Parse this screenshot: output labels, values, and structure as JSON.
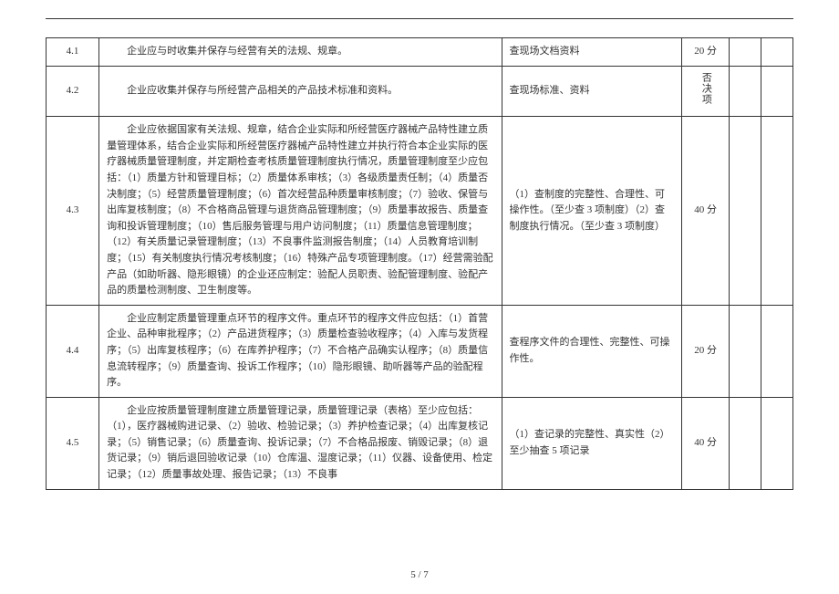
{
  "page": {
    "footer": "5 / 7"
  },
  "rows": {
    "r1": {
      "num": "4.1",
      "content": "企业应与时收集并保存与经营有关的法规、规章。",
      "method": "查现场文档资料",
      "score": "20 分"
    },
    "r2": {
      "num": "4.2",
      "content": "企业应收集并保存与所经营产品相关的产品技术标准和资料。",
      "method": "查现场标准、资料",
      "score": "否决项"
    },
    "r3": {
      "num": "4.3",
      "content": "企业应依据国家有关法规、规章，结合企业实际和所经营医疗器械产品特性建立质量管理体系，结合企业实际和所经营医疗器械产品特性建立并执行符合本企业实际的医疗器械质量管理制度，并定期检查考核质量管理制度执行情况，质量管理制度至少应包括：（1）质量方针和管理目标；（2）质量体系审核；（3）各级质量责任制；（4）质量否决制度；（5）经营质量管理制度；（6）首次经营品种质量审核制度；（7）验收、保管与出库复核制度；（8）不合格商品管理与退货商品管理制度；（9）质量事故报告、质量查询和投诉管理制度；（10）售后服务管理与用户访问制度；（11）质量信息管理制度；（12）有关质量记录管理制度；（13）不良事件监测报告制度；（14）人员教育培训制度；（15）有关制度执行情况考核制度；（16）特殊产品专项管理制度。（17）经营需验配产品（如助听器、隐形眼镜）的企业还应制定：验配人员职责、验配管理制度、验配产品的质量检测制度、卫生制度等。",
      "method": "（1）查制度的完整性、合理性、可操作性。（至少查 3 项制度）（2）查制度执行情况。（至少查 3 项制度）",
      "score": "40 分"
    },
    "r4": {
      "num": "4.4",
      "content": "企业应制定质量管理重点环节的程序文件。重点环节的程序文件应包括：（1）首营企业、品种审批程序；（2）产品进货程序；（3）质量检查验收程序；（4）入库与发货程序；（5）出库复核程序；（6）在库养护程序；（7）不合格产品确实认程序；（8）质量信息流转程序；（9）质量查询、投诉工作程序；（10）隐形眼镜、助听器等产品的验配程序。",
      "method": "查程序文件的合理性、完整性、可操作性。",
      "score": "20 分"
    },
    "r5": {
      "num": "4.5",
      "content": "企业应按质量管理制度建立质量管理记录，质量管理记录（表格）至少应包括：（1），医疗器械购进记录、（2）验收、检验记录；（3）养护检查记录；（4）出库复核记录；（5）销售记录；（6）质量查询、投诉记录；（7）不合格品报废、销毁记录；（8）退货记录；（9）销后退回验收记录（10）仓库温、湿度记录；（11）仪器、设备使用、检定记录；（12）质量事故处理、报告记录；（13）不良事",
      "method": "（1）查记录的完整性、真实性（2）至少抽查 5 项记录",
      "score": "40 分"
    }
  }
}
